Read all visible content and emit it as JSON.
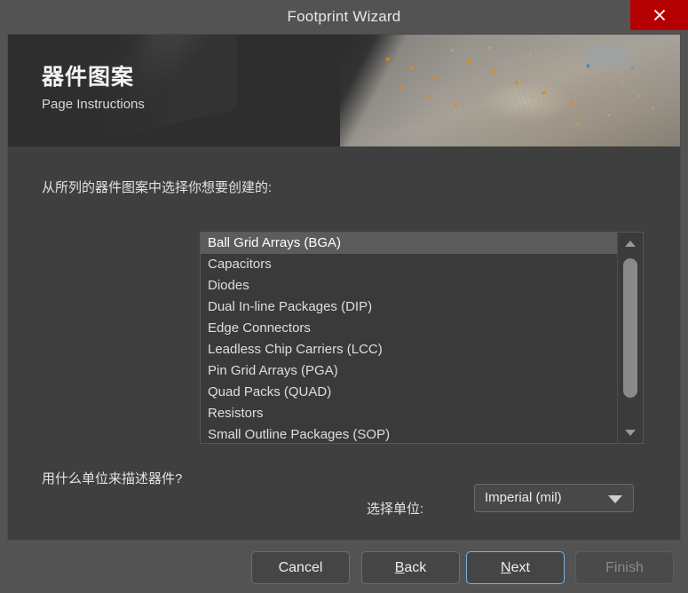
{
  "window": {
    "title": "Footprint Wizard",
    "close_icon": "close-icon",
    "close_label": "✕"
  },
  "banner": {
    "title": "器件图案",
    "subtitle": "Page Instructions",
    "artwork": "pcb-circuit-board-photo"
  },
  "body": {
    "list_prompt": "从所列的器件图案中选择你想要创建的:",
    "units_prompt": "用什么单位来描述器件?",
    "units_label": "选择单位:"
  },
  "listbox": {
    "selected_index": 0,
    "items": [
      "Ball Grid Arrays (BGA)",
      "Capacitors",
      "Diodes",
      "Dual In-line Packages (DIP)",
      "Edge Connectors",
      "Leadless Chip Carriers (LCC)",
      "Pin Grid Arrays (PGA)",
      "Quad Packs (QUAD)",
      "Resistors",
      "Small Outline Packages (SOP)"
    ],
    "scrollbar": {
      "up_icon": "chevron-up-icon",
      "down_icon": "chevron-down-icon"
    }
  },
  "units_combo": {
    "value": "Imperial (mil)",
    "arrow_icon": "chevron-down-icon"
  },
  "footer": {
    "cancel": "Cancel",
    "back_prefix": "",
    "back_mnemonic": "B",
    "back_suffix": "ack",
    "next_prefix": "",
    "next_mnemonic": "N",
    "next_suffix": "ext",
    "finish": "Finish"
  },
  "colors": {
    "window_chrome": "#535353",
    "dialog_body": "#3f3f3f",
    "banner_bg": "#2e2e2e",
    "close_red": "#b40000",
    "selection": "#5c5c5c",
    "focus_blue": "#7fb0dd",
    "text": "#e2e2e2",
    "disabled_text": "#8a8a8a"
  }
}
